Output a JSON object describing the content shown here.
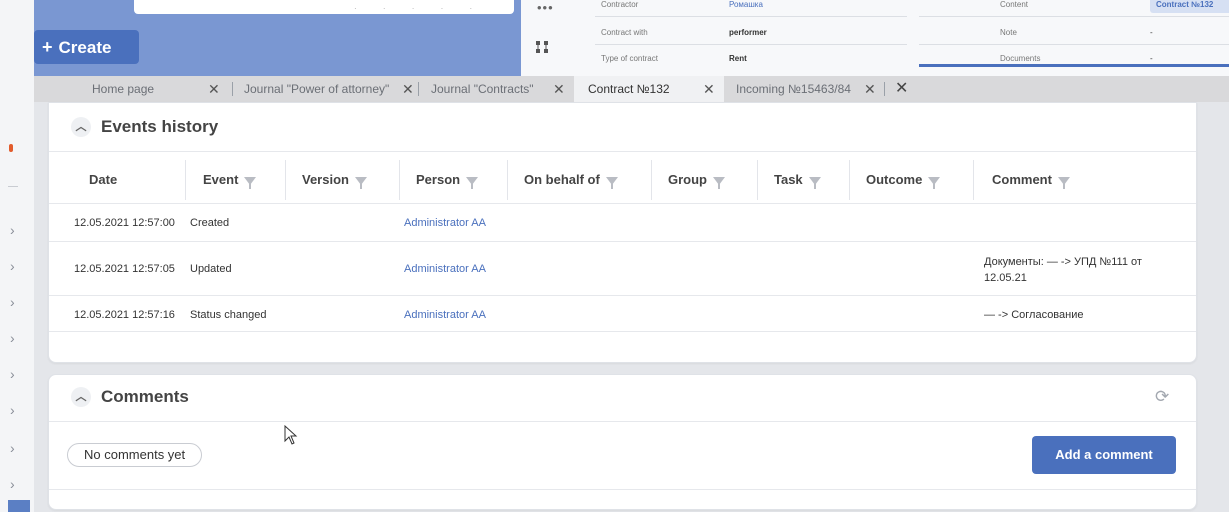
{
  "create_button": "Create",
  "details": {
    "contractor_label": "Contractor",
    "contractor_value": "Ромашка",
    "contract_with_label": "Contract with",
    "contract_with_value": "performer",
    "type_label": "Type of contract",
    "type_value": "Rent",
    "content_label": "Content",
    "content_value": "Contract №132",
    "note_label": "Note",
    "note_value": "-",
    "documents_label": "Documents",
    "documents_value": "-"
  },
  "tabs": [
    {
      "label": "Home page"
    },
    {
      "label": "Journal \"Power of attorney\""
    },
    {
      "label": "Journal \"Contracts\""
    },
    {
      "label": "Contract №132"
    },
    {
      "label": "Incoming №15463/84"
    }
  ],
  "events": {
    "title": "Events history",
    "columns": [
      "Date",
      "Event",
      "Version",
      "Person",
      "On behalf of",
      "Group",
      "Task",
      "Outcome",
      "Comment"
    ],
    "rows": [
      {
        "date": "12.05.2021 12:57:00",
        "event": "Created",
        "person": "Administrator AA",
        "comment": ""
      },
      {
        "date": "12.05.2021 12:57:05",
        "event": "Updated",
        "person": "Administrator AA",
        "comment": "Документы: — -> УПД №111 от 12.05.21"
      },
      {
        "date": "12.05.2021 12:57:16",
        "event": "Status changed",
        "person": "Administrator AA",
        "comment": "— -> Согласование"
      }
    ]
  },
  "comments": {
    "title": "Comments",
    "empty_label": "No comments yet",
    "add_button": "Add a comment"
  },
  "colors": {
    "accent": "#4a70bd",
    "top_panel": "#7a97d2"
  }
}
